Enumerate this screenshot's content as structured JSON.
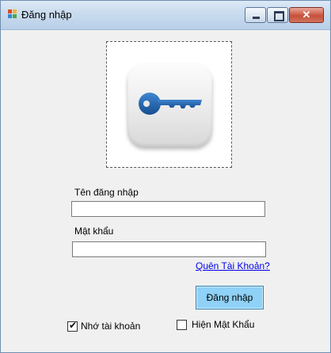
{
  "window": {
    "title": "Đăng nhập",
    "close_glyph": "✕"
  },
  "icons": {
    "app": "app-window-icon",
    "picture": "blue-key-icon"
  },
  "form": {
    "username_label": "Tên đăng nhập",
    "username_value": "",
    "password_label": "Mật khẩu",
    "password_value": "",
    "forgot_link": "Quên Tài Khoản?",
    "login_button": "Đăng nhập",
    "remember_label": "Nhớ tài khoản",
    "remember_checked": true,
    "show_password_label": "Hiện Mật Khẩu",
    "show_password_checked": false
  },
  "colors": {
    "login_button_bg": "#8fd1f7",
    "link": "#0000ee",
    "key_blue": "#1f5fa8"
  }
}
